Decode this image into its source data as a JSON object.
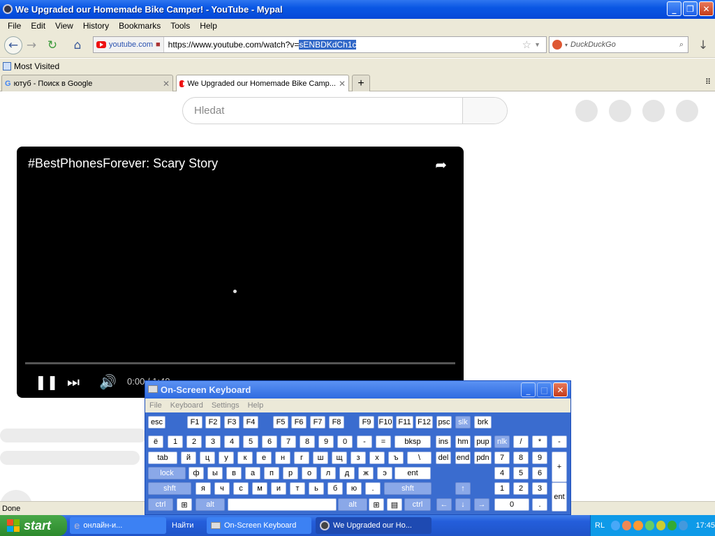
{
  "window": {
    "title": "We Upgraded our Homemade Bike Camper! - YouTube - Mypal"
  },
  "menu": [
    "File",
    "Edit",
    "View",
    "History",
    "Bookmarks",
    "Tools",
    "Help"
  ],
  "url": {
    "site": "youtube.com",
    "prefix": "https://www.youtube.com/watch?v=",
    "selected": "sENBDKdCh1c"
  },
  "search": {
    "placeholder": "DuckDuckGo"
  },
  "bookmarks": {
    "most_visited": "Most Visited"
  },
  "tabs": [
    {
      "label": "ютуб - Поиск в Google"
    },
    {
      "label": "We Upgraded our Homemade Bike Camp..."
    }
  ],
  "yt": {
    "search_placeholder": "Hledat"
  },
  "player": {
    "title": "#BestPhonesForever: Scary Story",
    "time": "0:00 / 1:48"
  },
  "status": "Done",
  "osk": {
    "title": "On-Screen Keyboard",
    "menu": [
      "File",
      "Keyboard",
      "Settings",
      "Help"
    ],
    "rows": [
      [
        "esc",
        "F1",
        "F2",
        "F3",
        "F4",
        "F5",
        "F6",
        "F7",
        "F8",
        "F9",
        "F10",
        "F11",
        "F12",
        "psc",
        "slk",
        "brk"
      ],
      [
        "ё",
        "1",
        "2",
        "3",
        "4",
        "5",
        "6",
        "7",
        "8",
        "9",
        "0",
        "-",
        "=",
        "bksp",
        "ins",
        "hm",
        "pup",
        "nlk",
        "/",
        "*",
        "-"
      ],
      [
        "tab",
        "й",
        "ц",
        "у",
        "к",
        "е",
        "н",
        "г",
        "ш",
        "щ",
        "з",
        "х",
        "ъ",
        "\\",
        "del",
        "end",
        "pdn",
        "7",
        "8",
        "9",
        "+"
      ],
      [
        "lock",
        "ф",
        "ы",
        "в",
        "а",
        "п",
        "р",
        "о",
        "л",
        "д",
        "ж",
        "э",
        "ent",
        "4",
        "5",
        "6"
      ],
      [
        "shft",
        "я",
        "ч",
        "с",
        "м",
        "и",
        "т",
        "ь",
        "б",
        "ю",
        ".",
        "shft",
        "1",
        "2",
        "3",
        "ent"
      ],
      [
        "ctrl",
        "alt",
        "alt",
        "ctrl",
        "0",
        "."
      ]
    ]
  },
  "taskbar": {
    "start": "start",
    "items": [
      "онлайн-и...",
      "Найти",
      "On-Screen Keyboard",
      "We Upgraded our Ho..."
    ],
    "lang": "RL",
    "clock": "17:45"
  }
}
